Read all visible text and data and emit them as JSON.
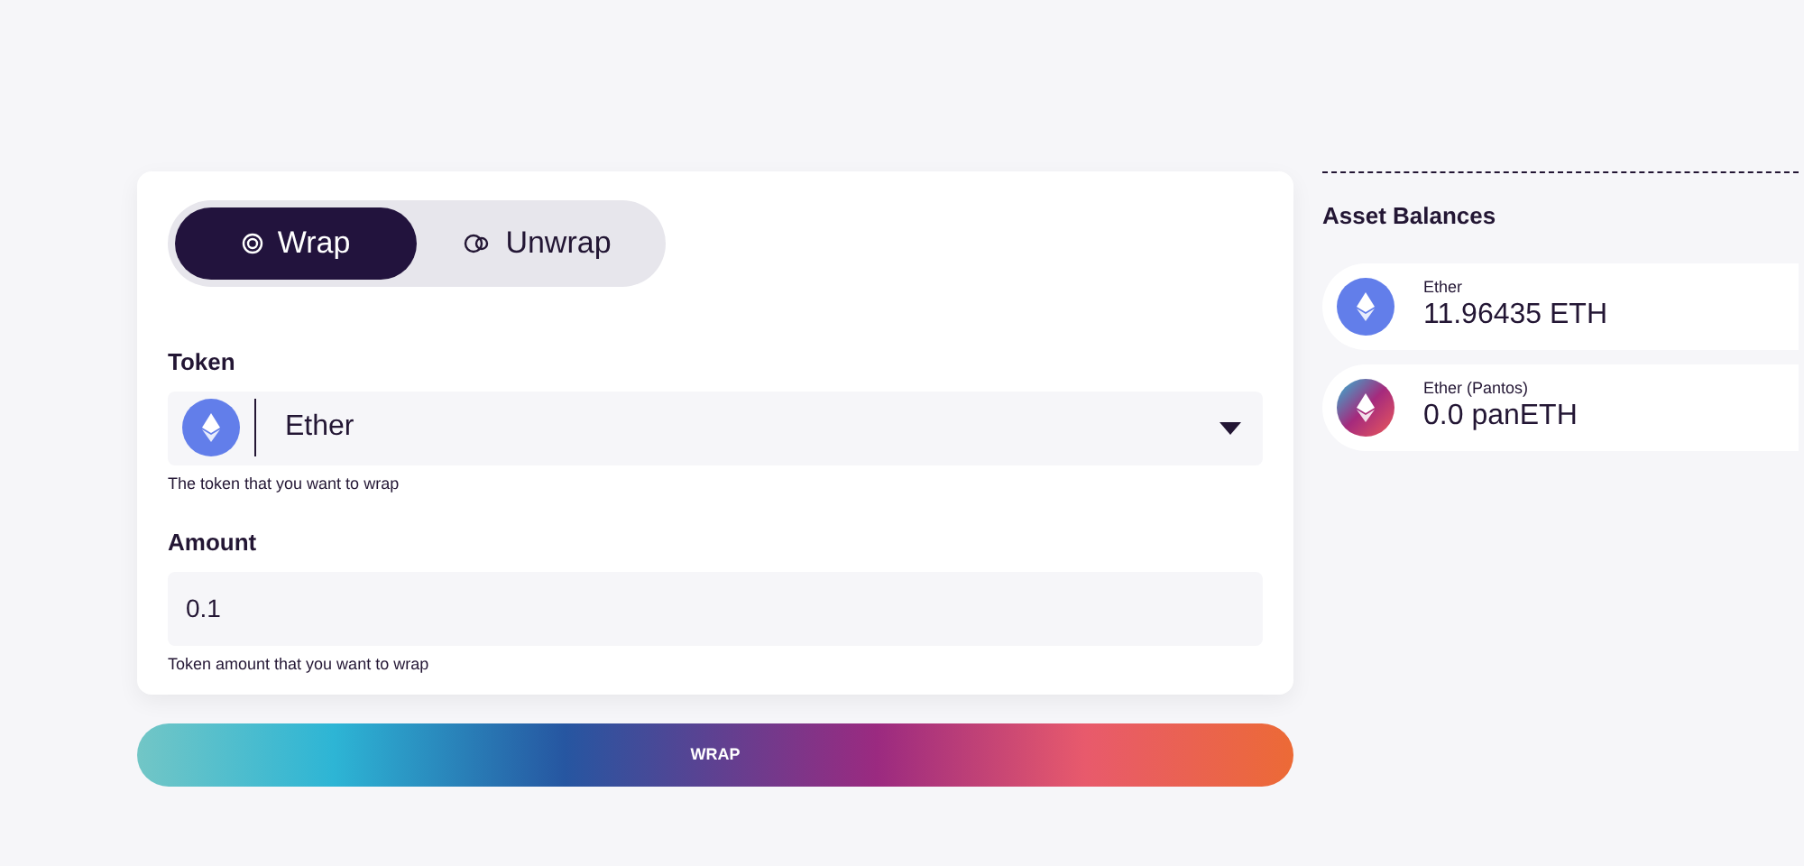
{
  "tabs": [
    {
      "label": "Wrap",
      "kind": "wrap",
      "selected": true
    },
    {
      "label": "Unwrap",
      "kind": "unwrap",
      "selected": false
    }
  ],
  "token": {
    "label": "Token",
    "value": "Ether",
    "hint": "The token that you want to wrap"
  },
  "amount": {
    "label": "Amount",
    "value": "0.1",
    "hint": "Token amount that you want to wrap"
  },
  "submit": "WRAP",
  "balances": {
    "title": "Asset Balances",
    "items": [
      {
        "name": "Ether",
        "amount": "11.96435 ETH",
        "kind": "eth"
      },
      {
        "name": "Ether (Pantos)",
        "amount": "0.0 panETH",
        "kind": "pan"
      }
    ]
  }
}
